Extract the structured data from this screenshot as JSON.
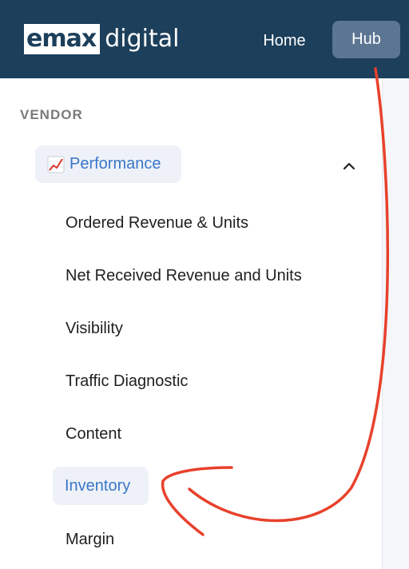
{
  "header": {
    "logo_box": "emax",
    "logo_word": "digital",
    "nav": {
      "home_label": "Home",
      "hub_label": "Hub"
    }
  },
  "sidebar": {
    "section_label": "VENDOR",
    "group": {
      "label": "Performance",
      "icon": "chart-increasing-icon",
      "expanded": true,
      "items": [
        {
          "label": "Ordered Revenue & Units",
          "active": false
        },
        {
          "label": "Net Received Revenue and Units",
          "active": false
        },
        {
          "label": "Visibility",
          "active": false
        },
        {
          "label": "Traffic Diagnostic",
          "active": false
        },
        {
          "label": "Content",
          "active": false
        },
        {
          "label": "Inventory",
          "active": true
        },
        {
          "label": "Margin",
          "active": false
        }
      ]
    }
  },
  "colors": {
    "header_bg": "#1c3f5b",
    "hub_bg": "#5c7592",
    "accent_text": "#3b76c9",
    "active_bg": "#eef2f8",
    "annotation": "#e8412c"
  }
}
